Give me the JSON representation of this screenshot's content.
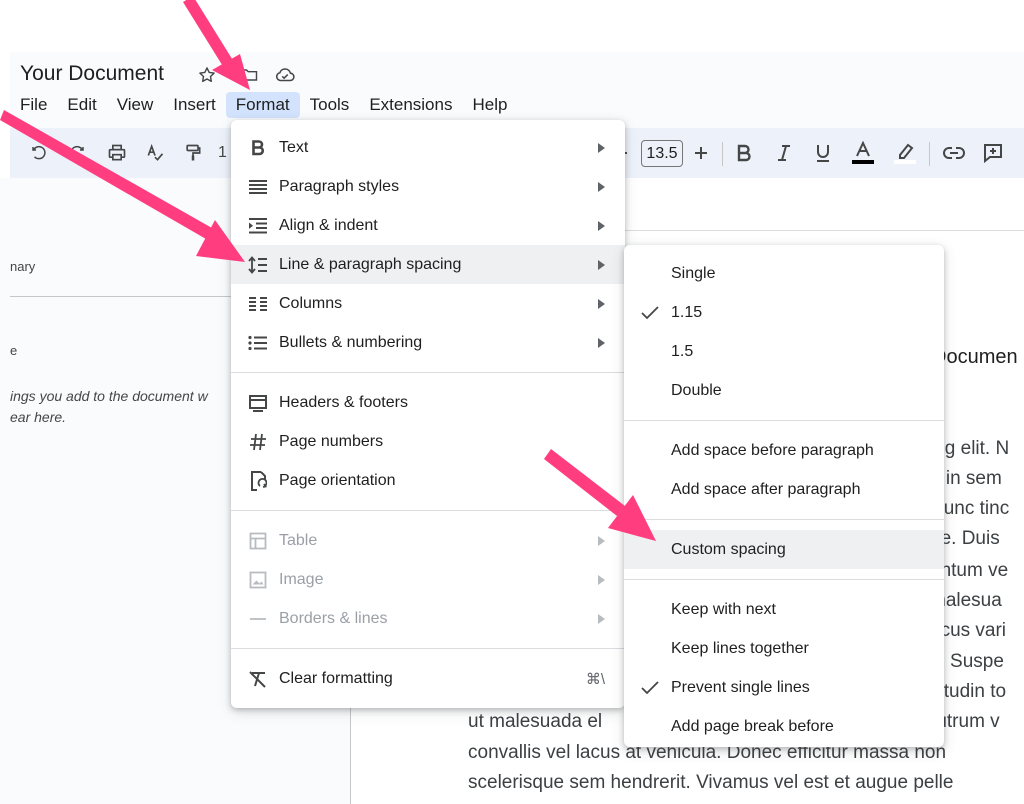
{
  "colors": {
    "annotation_arrow": "#ff3d7f",
    "menu_active": "#d3e3fd",
    "toolbar_bg": "#edf2fa"
  },
  "document": {
    "title": "Your Document"
  },
  "title_icons": [
    "star-icon",
    "move-to-folder-icon",
    "cloud-saved-icon"
  ],
  "menubar": [
    "File",
    "Edit",
    "View",
    "Insert",
    "Format",
    "Tools",
    "Extensions",
    "Help"
  ],
  "toolbar": {
    "font_size": "13.5"
  },
  "outline": {
    "tab_fragment": "nary",
    "heading_fragment": "e",
    "hint_line1": "ings you add to the document w",
    "hint_line2": "ear here."
  },
  "format_menu": {
    "items": [
      {
        "label": "Text",
        "icon": "bold-icon",
        "submenu": true
      },
      {
        "label": "Paragraph styles",
        "icon": "paragraph-styles-icon",
        "submenu": true
      },
      {
        "label": "Align & indent",
        "icon": "indent-icon",
        "submenu": true
      },
      {
        "label": "Line & paragraph spacing",
        "icon": "line-spacing-icon",
        "submenu": true
      },
      {
        "label": "Columns",
        "icon": "columns-icon",
        "submenu": true
      },
      {
        "label": "Bullets & numbering",
        "icon": "bullet-list-icon",
        "submenu": true
      },
      {
        "label": "Headers & footers",
        "icon": "header-footer-icon",
        "submenu": false
      },
      {
        "label": "Page numbers",
        "icon": "hash-icon",
        "submenu": false
      },
      {
        "label": "Page orientation",
        "icon": "page-orientation-icon",
        "submenu": false
      },
      {
        "label": "Table",
        "icon": "table-icon",
        "submenu": true,
        "disabled": true
      },
      {
        "label": "Image",
        "icon": "image-icon",
        "submenu": true,
        "disabled": true
      },
      {
        "label": "Borders & lines",
        "icon": "borders-icon",
        "submenu": true,
        "disabled": true
      },
      {
        "label": "Clear formatting",
        "icon": "clear-formatting-icon",
        "shortcut": "⌘\\"
      }
    ]
  },
  "spacing_submenu": {
    "items": [
      {
        "label": "Single",
        "checked": false
      },
      {
        "label": "1.15",
        "checked": true
      },
      {
        "label": "1.5",
        "checked": false
      },
      {
        "label": "Double",
        "checked": false
      },
      {
        "label": "Add space before paragraph",
        "checked": false
      },
      {
        "label": "Add space after paragraph",
        "checked": false
      },
      {
        "label": "Custom spacing",
        "checked": false
      },
      {
        "label": "Keep with next",
        "checked": false
      },
      {
        "label": "Keep lines together",
        "checked": false
      },
      {
        "label": "Prevent single lines",
        "checked": true
      },
      {
        "label": "Add page break before",
        "checked": false
      }
    ]
  },
  "page": {
    "heading_fragment": "Documen",
    "right_lines": [
      "ing elit. N",
      "n in sem",
      "Nunc tinc",
      "ue. Duis",
      "entum ve",
      "malesua",
      "acus vari",
      "s. Suspe",
      "citudin to",
      "rutrum v"
    ],
    "body_lines": [
      "ut malesuada el",
      "convallis vel lacus at vehicula. Donec efficitur massa non",
      "scelerisque sem hendrerit. Vivamus vel est et augue pelle"
    ]
  }
}
